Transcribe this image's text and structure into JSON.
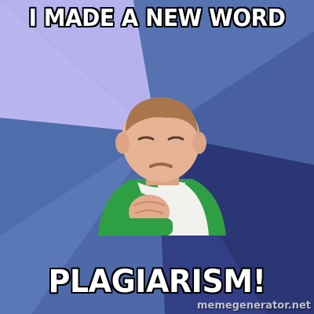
{
  "meme": {
    "top_text": "I MADE A NEW WORD",
    "bottom_text": "PLAGIARISM!",
    "watermark": "memegenerator.net"
  },
  "colors": {
    "ray_light": "#b8b4ee",
    "ray_mid": "#5c74b4",
    "ray_dark": "#3b4a8e",
    "ray_navy": "#27306a",
    "text": "#ffffff",
    "text_outline": "#000000",
    "shirt_green": "#2fa043",
    "shirt_white": "#f3f3f0",
    "skin": "#e3b091"
  },
  "icons": {
    "subject": "baby-fist-pump"
  }
}
